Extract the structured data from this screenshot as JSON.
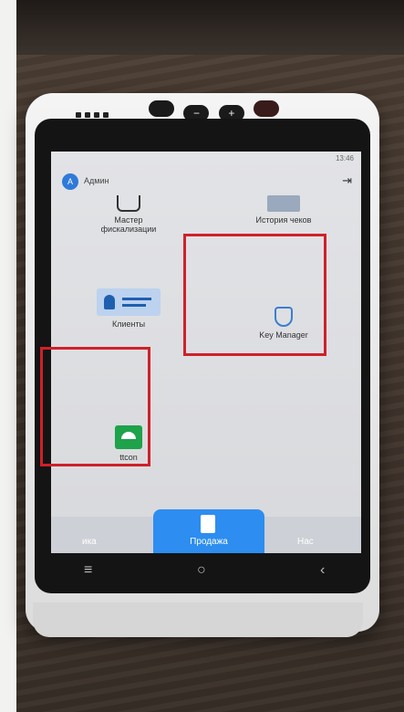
{
  "status": {
    "time": "13:46"
  },
  "header": {
    "avatar_letter": "A",
    "username": "Админ",
    "logout_icon": "logout-icon"
  },
  "tiles": [
    {
      "label_line1": "Мастер",
      "label_line2": "фискализации",
      "icon": "receipt-icon"
    },
    {
      "label": "История чеков",
      "icon": "history-icon"
    },
    {
      "label": "Клиенты",
      "icon": "id-card-icon"
    },
    {
      "label": "Key Manager",
      "icon": "shield-icon"
    },
    {
      "label": "ttcon",
      "icon": "ttcon-app-icon"
    }
  ],
  "bottom_nav": [
    {
      "label": "ика"
    },
    {
      "label": "Продажа"
    },
    {
      "label": "Нас"
    }
  ],
  "colors": {
    "accent": "#2d8df0",
    "highlight": "#d0202a",
    "ttcon_green": "#1ea24a"
  }
}
